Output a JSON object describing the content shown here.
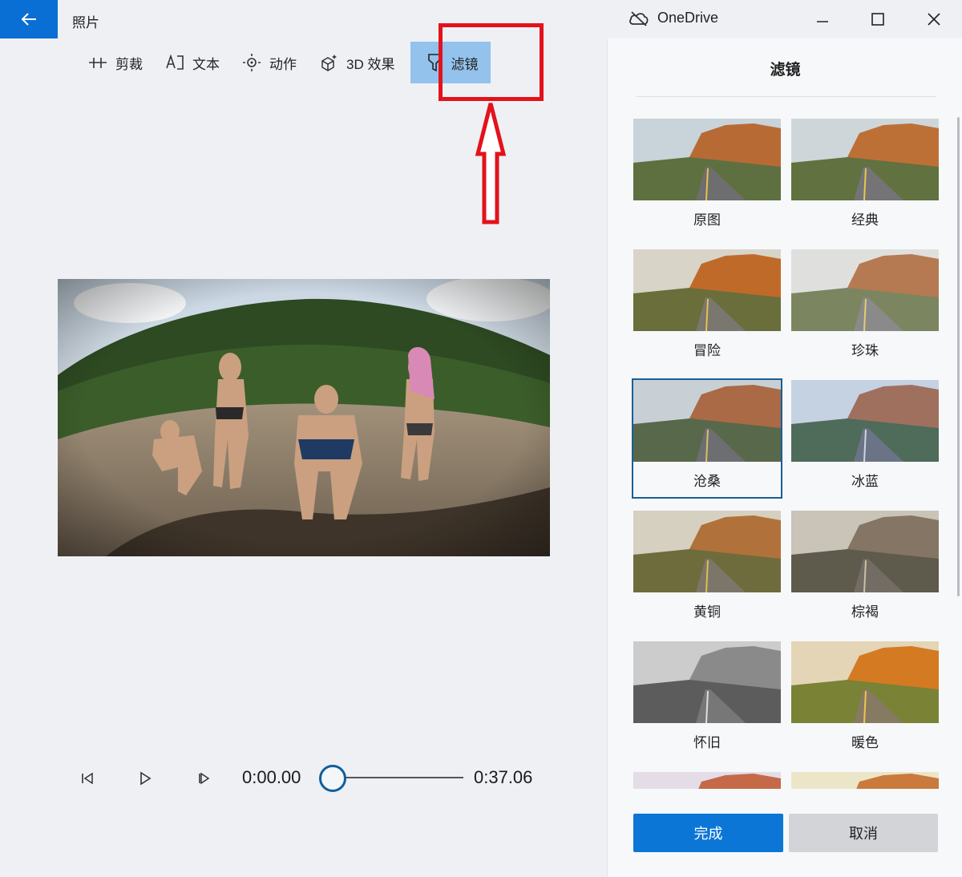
{
  "window": {
    "app_title": "照片",
    "onedrive_label": "OneDrive",
    "back_icon": "arrow-left-icon",
    "controls": [
      "minimize-icon",
      "maximize-icon",
      "close-icon"
    ]
  },
  "toolbar": {
    "items": [
      {
        "label": "剪裁",
        "icon": "trim-icon"
      },
      {
        "label": "文本",
        "icon": "text-icon"
      },
      {
        "label": "动作",
        "icon": "motion-icon"
      },
      {
        "label": "3D 效果",
        "icon": "effects-3d-icon"
      },
      {
        "label": "滤镜",
        "icon": "filter-icon",
        "active": true
      }
    ]
  },
  "playback": {
    "current_time": "0:00.00",
    "duration": "0:37.06",
    "progress": 0.0
  },
  "panel": {
    "title": "滤镜",
    "filters": [
      {
        "label": "原图"
      },
      {
        "label": "经典"
      },
      {
        "label": "冒险"
      },
      {
        "label": "珍珠"
      },
      {
        "label": "沧桑",
        "selected": true
      },
      {
        "label": "冰蓝"
      },
      {
        "label": "黄铜"
      },
      {
        "label": "棕褐"
      },
      {
        "label": "怀旧"
      },
      {
        "label": "暖色"
      }
    ],
    "done_label": "完成",
    "cancel_label": "取消"
  },
  "colors": {
    "accent": "#0b76d6",
    "active_tab": "#93c2ec",
    "annotation": "#e3121b"
  }
}
